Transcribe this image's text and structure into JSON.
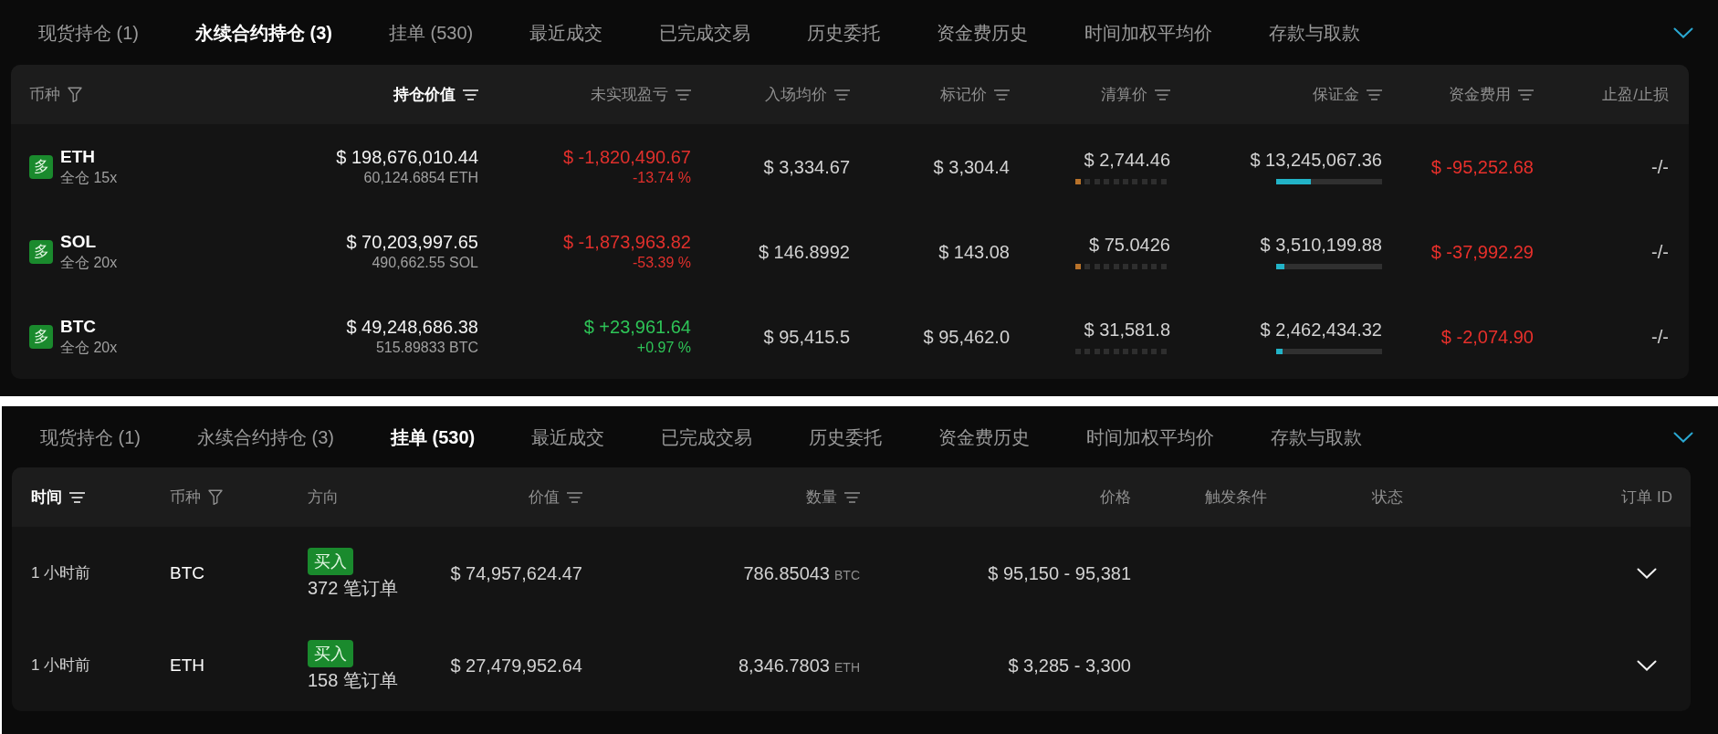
{
  "positions_panel": {
    "tabs": [
      {
        "label": "现货持仓 (1)",
        "selected": false
      },
      {
        "label": "永续合约持仓 (3)",
        "selected": true
      },
      {
        "label": "挂单 (530)",
        "selected": false
      },
      {
        "label": "最近成交",
        "selected": false
      },
      {
        "label": "已完成交易",
        "selected": false
      },
      {
        "label": "历史委托",
        "selected": false
      },
      {
        "label": "资金费历史",
        "selected": false
      },
      {
        "label": "时间加权平均价",
        "selected": false
      },
      {
        "label": "存款与取款",
        "selected": false
      }
    ],
    "table": {
      "columns": [
        {
          "label": "币种",
          "kind": "filter",
          "selected": false
        },
        {
          "label": "持仓价值",
          "kind": "sort",
          "selected": true
        },
        {
          "label": "未实现盈亏",
          "kind": "sort",
          "selected": false
        },
        {
          "label": "入场均价",
          "kind": "sort",
          "selected": false
        },
        {
          "label": "标记价",
          "kind": "sort",
          "selected": false
        },
        {
          "label": "清算价",
          "kind": "sort",
          "selected": false
        },
        {
          "label": "保证金",
          "kind": "sort",
          "selected": false
        },
        {
          "label": "资金费用",
          "kind": "sort",
          "selected": false
        },
        {
          "label": "止盈/止损",
          "kind": "plain",
          "selected": false
        }
      ],
      "rows": [
        {
          "side": "多",
          "symbol": "ETH",
          "margin_mode": "全仓 15x",
          "position_value": "$ 198,676,010.44",
          "position_size": "60,124.6854 ETH",
          "pnl": {
            "value": "$ -1,820,490.67",
            "percent": "-13.74 %",
            "color": "#e0302c"
          },
          "entry_price": "$ 3,334.67",
          "mark_price": "$ 3,304.4",
          "liquidation_price": "$ 2,744.46",
          "liquidation_meter": {
            "level": 0.1
          },
          "margin": "$ 13,245,067.36",
          "margin_bar": {
            "level": 0.33
          },
          "funding_fee": "$ -95,252.68",
          "tp_sl": "-/-"
        },
        {
          "side": "多",
          "symbol": "SOL",
          "margin_mode": "全仓 20x",
          "position_value": "$ 70,203,997.65",
          "position_size": "490,662.55 SOL",
          "pnl": {
            "value": "$ -1,873,963.82",
            "percent": "-53.39 %",
            "color": "#e0302c"
          },
          "entry_price": "$ 146.8992",
          "mark_price": "$ 143.08",
          "liquidation_price": "$ 75.0426",
          "liquidation_meter": {
            "level": 0.1
          },
          "margin": "$ 3,510,199.88",
          "margin_bar": {
            "level": 0.08
          },
          "funding_fee": "$ -37,992.29",
          "tp_sl": "-/-"
        },
        {
          "side": "多",
          "symbol": "BTC",
          "margin_mode": "全仓 20x",
          "position_value": "$ 49,248,686.38",
          "position_size": "515.89833 BTC",
          "pnl": {
            "value": "$ +23,961.64",
            "percent": "+0.97 %",
            "color": "#2ec457"
          },
          "entry_price": "$ 95,415.5",
          "mark_price": "$ 95,462.0",
          "liquidation_price": "$ 31,581.8",
          "liquidation_meter": {
            "level": 0
          },
          "margin": "$ 2,462,434.32",
          "margin_bar": {
            "level": 0.06
          },
          "funding_fee": "$ -2,074.90",
          "tp_sl": "-/-"
        }
      ]
    }
  },
  "orders_panel": {
    "tabs": [
      {
        "label": "现货持仓 (1)",
        "selected": false
      },
      {
        "label": "永续合约持仓 (3)",
        "selected": false
      },
      {
        "label": "挂单 (530)",
        "selected": true
      },
      {
        "label": "最近成交",
        "selected": false
      },
      {
        "label": "已完成交易",
        "selected": false
      },
      {
        "label": "历史委托",
        "selected": false
      },
      {
        "label": "资金费历史",
        "selected": false
      },
      {
        "label": "时间加权平均价",
        "selected": false
      },
      {
        "label": "存款与取款",
        "selected": false
      }
    ],
    "table": {
      "columns": [
        {
          "label": "时间",
          "kind": "sort",
          "selected": true
        },
        {
          "label": "币种",
          "kind": "filter",
          "selected": false
        },
        {
          "label": "方向",
          "kind": "plain",
          "selected": false
        },
        {
          "label": "价值",
          "kind": "sort",
          "selected": false
        },
        {
          "label": "数量",
          "kind": "sort",
          "selected": false
        },
        {
          "label": "价格",
          "kind": "plain",
          "selected": false
        },
        {
          "label": "触发条件",
          "kind": "plain",
          "selected": false
        },
        {
          "label": "状态",
          "kind": "plain",
          "selected": false
        },
        {
          "label": "订单 ID",
          "kind": "plain",
          "selected": false
        }
      ],
      "rows": [
        {
          "time": "1 小时前",
          "symbol": "BTC",
          "side": "买入",
          "order_count": "372 笔订单",
          "value": "$ 74,957,624.47",
          "quantity": "786.85043",
          "unit": "BTC",
          "price": "$ 95,150 - 95,381",
          "expanded": false
        },
        {
          "time": "1 小时前",
          "symbol": "ETH",
          "side": "买入",
          "order_count": "158 笔订单",
          "value": "$ 27,479,952.64",
          "quantity": "8,346.7803",
          "unit": "ETH",
          "price": "$ 3,285 - 3,300",
          "expanded": false
        }
      ]
    }
  }
}
